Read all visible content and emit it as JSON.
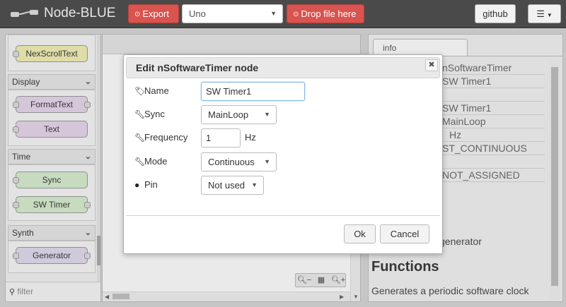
{
  "header": {
    "app_title": "Node-BLUE",
    "export_label": "Export",
    "board_select": "Uno",
    "drop_label": "Drop file here",
    "github_label": "github",
    "menu_icon": "menu-icon"
  },
  "palette": {
    "nodes_top": [
      {
        "label": "NexScrollText"
      }
    ],
    "categories": [
      {
        "name": "Display",
        "nodes": [
          {
            "label": "FormatText"
          },
          {
            "label": "Text"
          }
        ]
      },
      {
        "name": "Time",
        "nodes": [
          {
            "label": "Sync"
          },
          {
            "label": "SW Timer"
          }
        ]
      },
      {
        "name": "Synth",
        "nodes": [
          {
            "label": "Generator"
          }
        ]
      }
    ],
    "filter_placeholder": "filter"
  },
  "colors": {
    "header_bg": "#4a4a4a",
    "accent_red": "#d9534f",
    "node_yellow": "#f3f0b4",
    "node_pink": "#e9d7ed",
    "node_green": "#d8efcf",
    "node_purple": "#e3dbee"
  },
  "sidebar": {
    "tab_label": "info",
    "info_rows": [
      "nSoftwareTimer",
      "SW Timer1",
      "",
      "SW Timer1",
      "MainLoop",
      "Hz",
      "ST_CONTINUOUS",
      "",
      "NOT_ASSIGNED"
    ],
    "description": "generator",
    "functions_title": "Functions",
    "functions_text": "Generates a periodic software clock"
  },
  "dialog": {
    "title": "Edit nSoftwareTimer node",
    "close_icon": "close-icon",
    "fields": {
      "name_label": "Name",
      "name_value": "SW Timer1",
      "sync_label": "Sync",
      "sync_value": "MainLoop",
      "frequency_label": "Frequency",
      "frequency_value": "1",
      "frequency_unit": "Hz",
      "mode_label": "Mode",
      "mode_value": "Continuous",
      "pin_label": "Pin",
      "pin_value": "Not used"
    },
    "ok_label": "Ok",
    "cancel_label": "Cancel"
  }
}
